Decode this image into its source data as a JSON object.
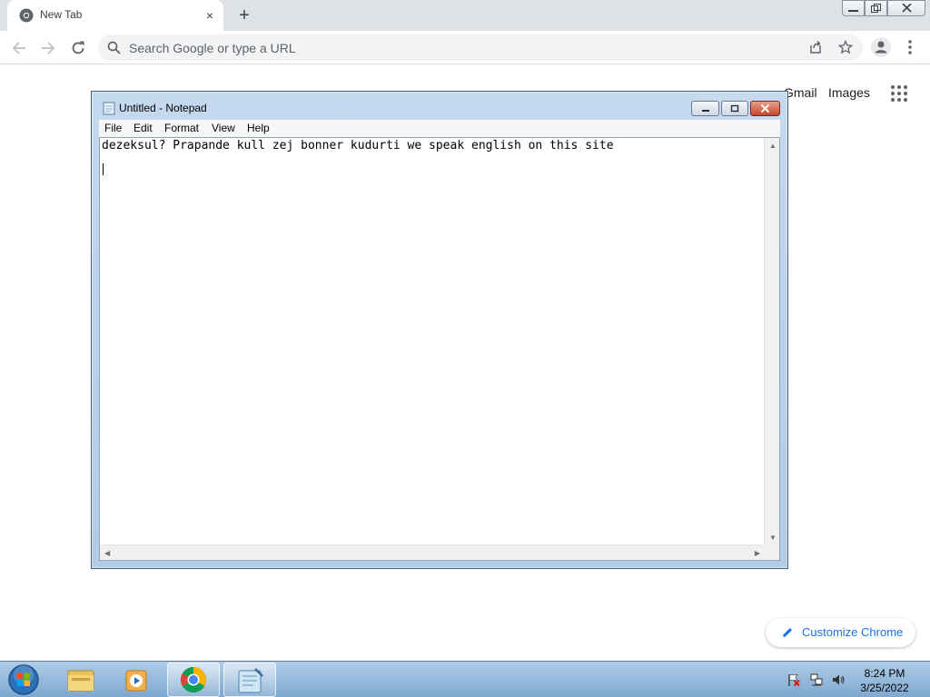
{
  "browser": {
    "tab_title": "New Tab",
    "tab_close_glyph": "×",
    "new_tab_glyph": "+",
    "omnibox_placeholder": "Search Google or type a URL",
    "icons": [
      "chrome-favicon",
      "back-icon",
      "forward-icon",
      "reload-icon",
      "search-icon",
      "share-icon",
      "bookmark-star-icon",
      "profile-icon",
      "menu-dots-icon",
      "minimize-icon",
      "restore-icon",
      "close-icon"
    ]
  },
  "ntp": {
    "gmail": "Gmail",
    "images": "Images",
    "customize": "Customize Chrome",
    "accent": "#1a73e8"
  },
  "notepad": {
    "title": "Untitled - Notepad",
    "menu": [
      "File",
      "Edit",
      "Format",
      "View",
      "Help"
    ],
    "content": "dezeksul? Prapande kull zej bonner kudurti we speak english on this site"
  },
  "taskbar": {
    "apps": [
      "start-orb",
      "explorer",
      "media-player",
      "chrome",
      "notepad"
    ],
    "time": "8:24 PM",
    "date": "3/25/2022"
  }
}
